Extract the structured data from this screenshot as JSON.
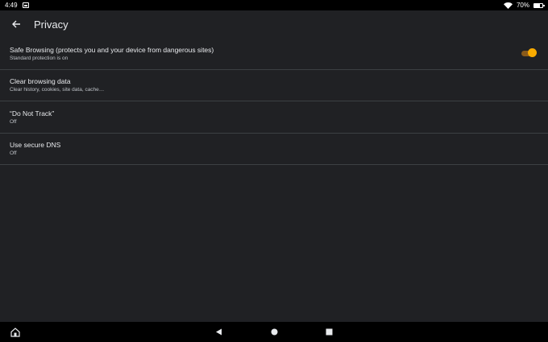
{
  "status_bar": {
    "time": "4:49",
    "battery_percent": "70%",
    "battery_level": 0.7,
    "icons": [
      "image-notification-icon",
      "wifi-icon",
      "battery-icon"
    ]
  },
  "app_bar": {
    "title": "Privacy",
    "back_icon": "arrow-back-icon"
  },
  "settings": [
    {
      "title": "Safe Browsing (protects you and your device from dangerous sites)",
      "summary": "Standard protection is on",
      "toggle": true
    },
    {
      "title": "Clear browsing data",
      "summary": "Clear history, cookies, site data, cache…"
    },
    {
      "title": "“Do Not Track”",
      "summary": "Off"
    },
    {
      "title": "Use secure DNS",
      "summary": "Off"
    }
  ],
  "colors": {
    "background": "#202124",
    "divider": "#3c4043",
    "accent": "#f9ab00"
  },
  "nav_bar": {
    "icons": [
      "home-icon",
      "back-triangle-icon",
      "home-circle-icon",
      "recents-square-icon"
    ]
  }
}
